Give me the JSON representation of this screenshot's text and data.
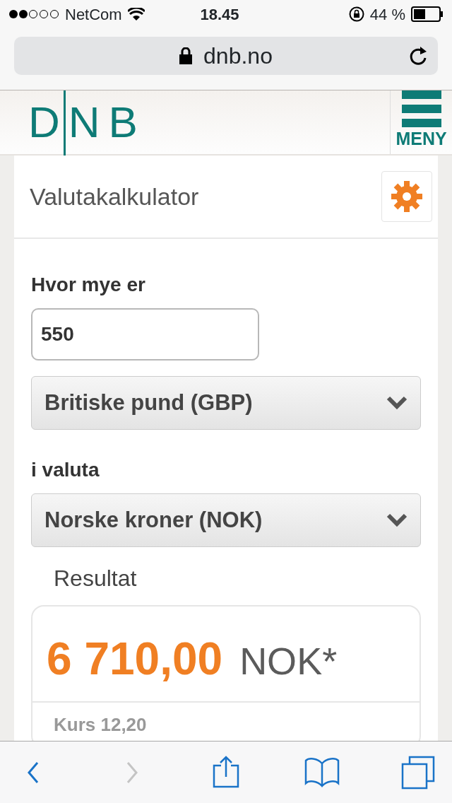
{
  "status_bar": {
    "carrier": "NetCom",
    "time": "18.45",
    "battery": "44 %"
  },
  "address_bar": {
    "url": "dnb.no"
  },
  "header": {
    "logo": "DNB",
    "menu_label": "MENY"
  },
  "calculator": {
    "title": "Valutakalkulator",
    "amount_label": "Hvor mye er",
    "amount": "550",
    "from_currency": "Britiske pund (GBP)",
    "to_label": "i valuta",
    "to_currency": "Norske kroner (NOK)",
    "result_label": "Resultat",
    "result_amount": "6 710,00",
    "result_unit": "NOK*",
    "rate": "Kurs 12,20"
  },
  "toolbar": [
    {
      "kind": "back",
      "disabled": false
    },
    {
      "kind": "forward",
      "disabled": true
    },
    {
      "kind": "share",
      "disabled": false
    },
    {
      "kind": "bookmarks",
      "disabled": false
    },
    {
      "kind": "tabs",
      "disabled": false
    }
  ]
}
